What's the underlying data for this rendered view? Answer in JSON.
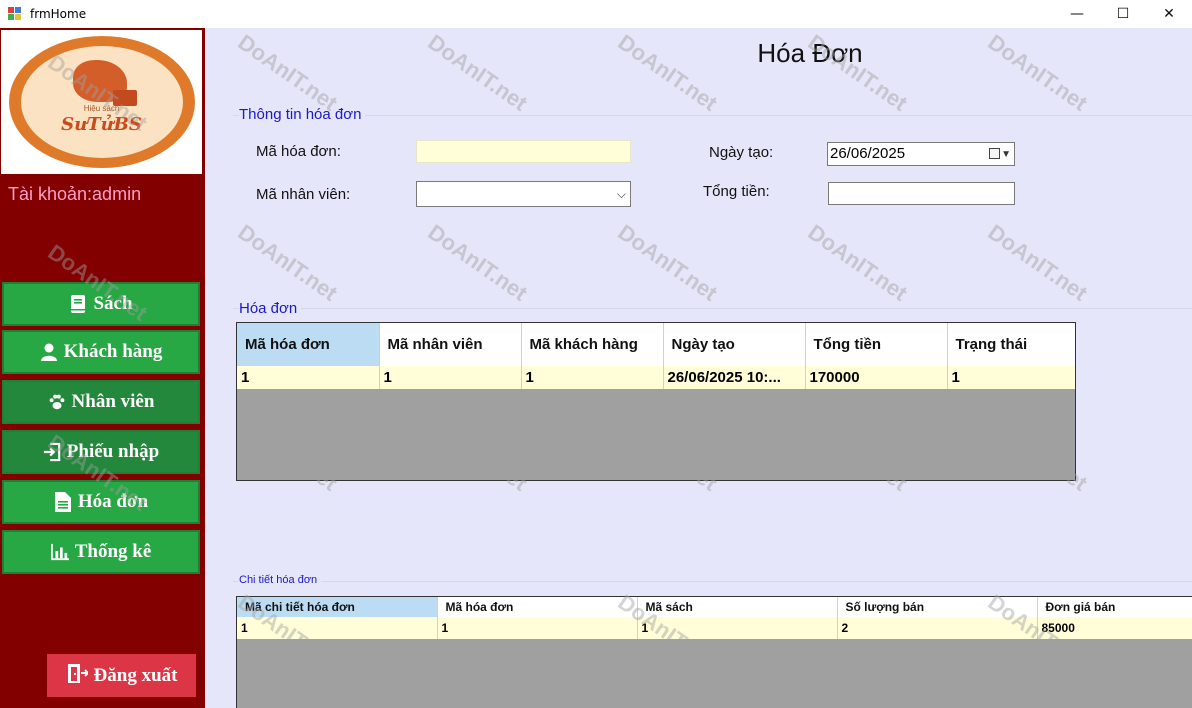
{
  "window": {
    "title": "frmHome",
    "controls": {
      "minimize": "—",
      "maximize": "☐",
      "close": "✕"
    }
  },
  "sidebar": {
    "logo": {
      "brand": "SưTửBS",
      "tagline": "Hiệu sách"
    },
    "account_label": "Tài khoản:admin",
    "nav": [
      {
        "label": "Sách",
        "icon": "book-icon"
      },
      {
        "label": "Khách hàng",
        "icon": "user-icon"
      },
      {
        "label": "Nhân viên",
        "icon": "paw-icon"
      },
      {
        "label": "Phiếu nhập",
        "icon": "import-icon"
      },
      {
        "label": "Hóa đơn",
        "icon": "document-icon"
      },
      {
        "label": "Thống kê",
        "icon": "chart-icon"
      }
    ],
    "logout_label": "Đăng xuất"
  },
  "main": {
    "title": "Hóa Đơn",
    "info_group": {
      "legend": "Thông tin hóa đơn",
      "invoice_id_label": "Mã hóa đơn:",
      "invoice_id_value": "",
      "employee_id_label": "Mã nhân viên:",
      "employee_id_value": "",
      "created_date_label": "Ngày tạo:",
      "created_date_value": "26/06/2025",
      "total_label": "Tổng tiền:",
      "total_value": ""
    },
    "invoice_group": {
      "legend": "Hóa đơn",
      "columns": [
        "Mã hóa đơn",
        "Mã nhân viên",
        "Mã khách hàng",
        "Ngày tạo",
        "Tổng tiền",
        "Trạng thái"
      ],
      "rows": [
        [
          "1",
          "1",
          "1",
          "26/06/2025 10:...",
          "170000",
          "1"
        ]
      ]
    },
    "detail_group": {
      "legend": "Chi tiết hóa đơn",
      "columns": [
        "Mã chi tiết hóa đơn",
        "Mã hóa đơn",
        "Mã sách",
        "Số lượng bán",
        "Đơn giá bán"
      ],
      "rows": [
        [
          "1",
          "1",
          "1",
          "2",
          "85000"
        ]
      ]
    }
  },
  "watermark": "DoAnIT.net",
  "colors": {
    "sidebar_bg": "#820000",
    "nav_green": "#28a745",
    "logout_red": "#dc3545",
    "main_bg": "#e6e6fa",
    "legend_blue": "#1a1ac8",
    "readonly_yellow": "#fffed8"
  }
}
